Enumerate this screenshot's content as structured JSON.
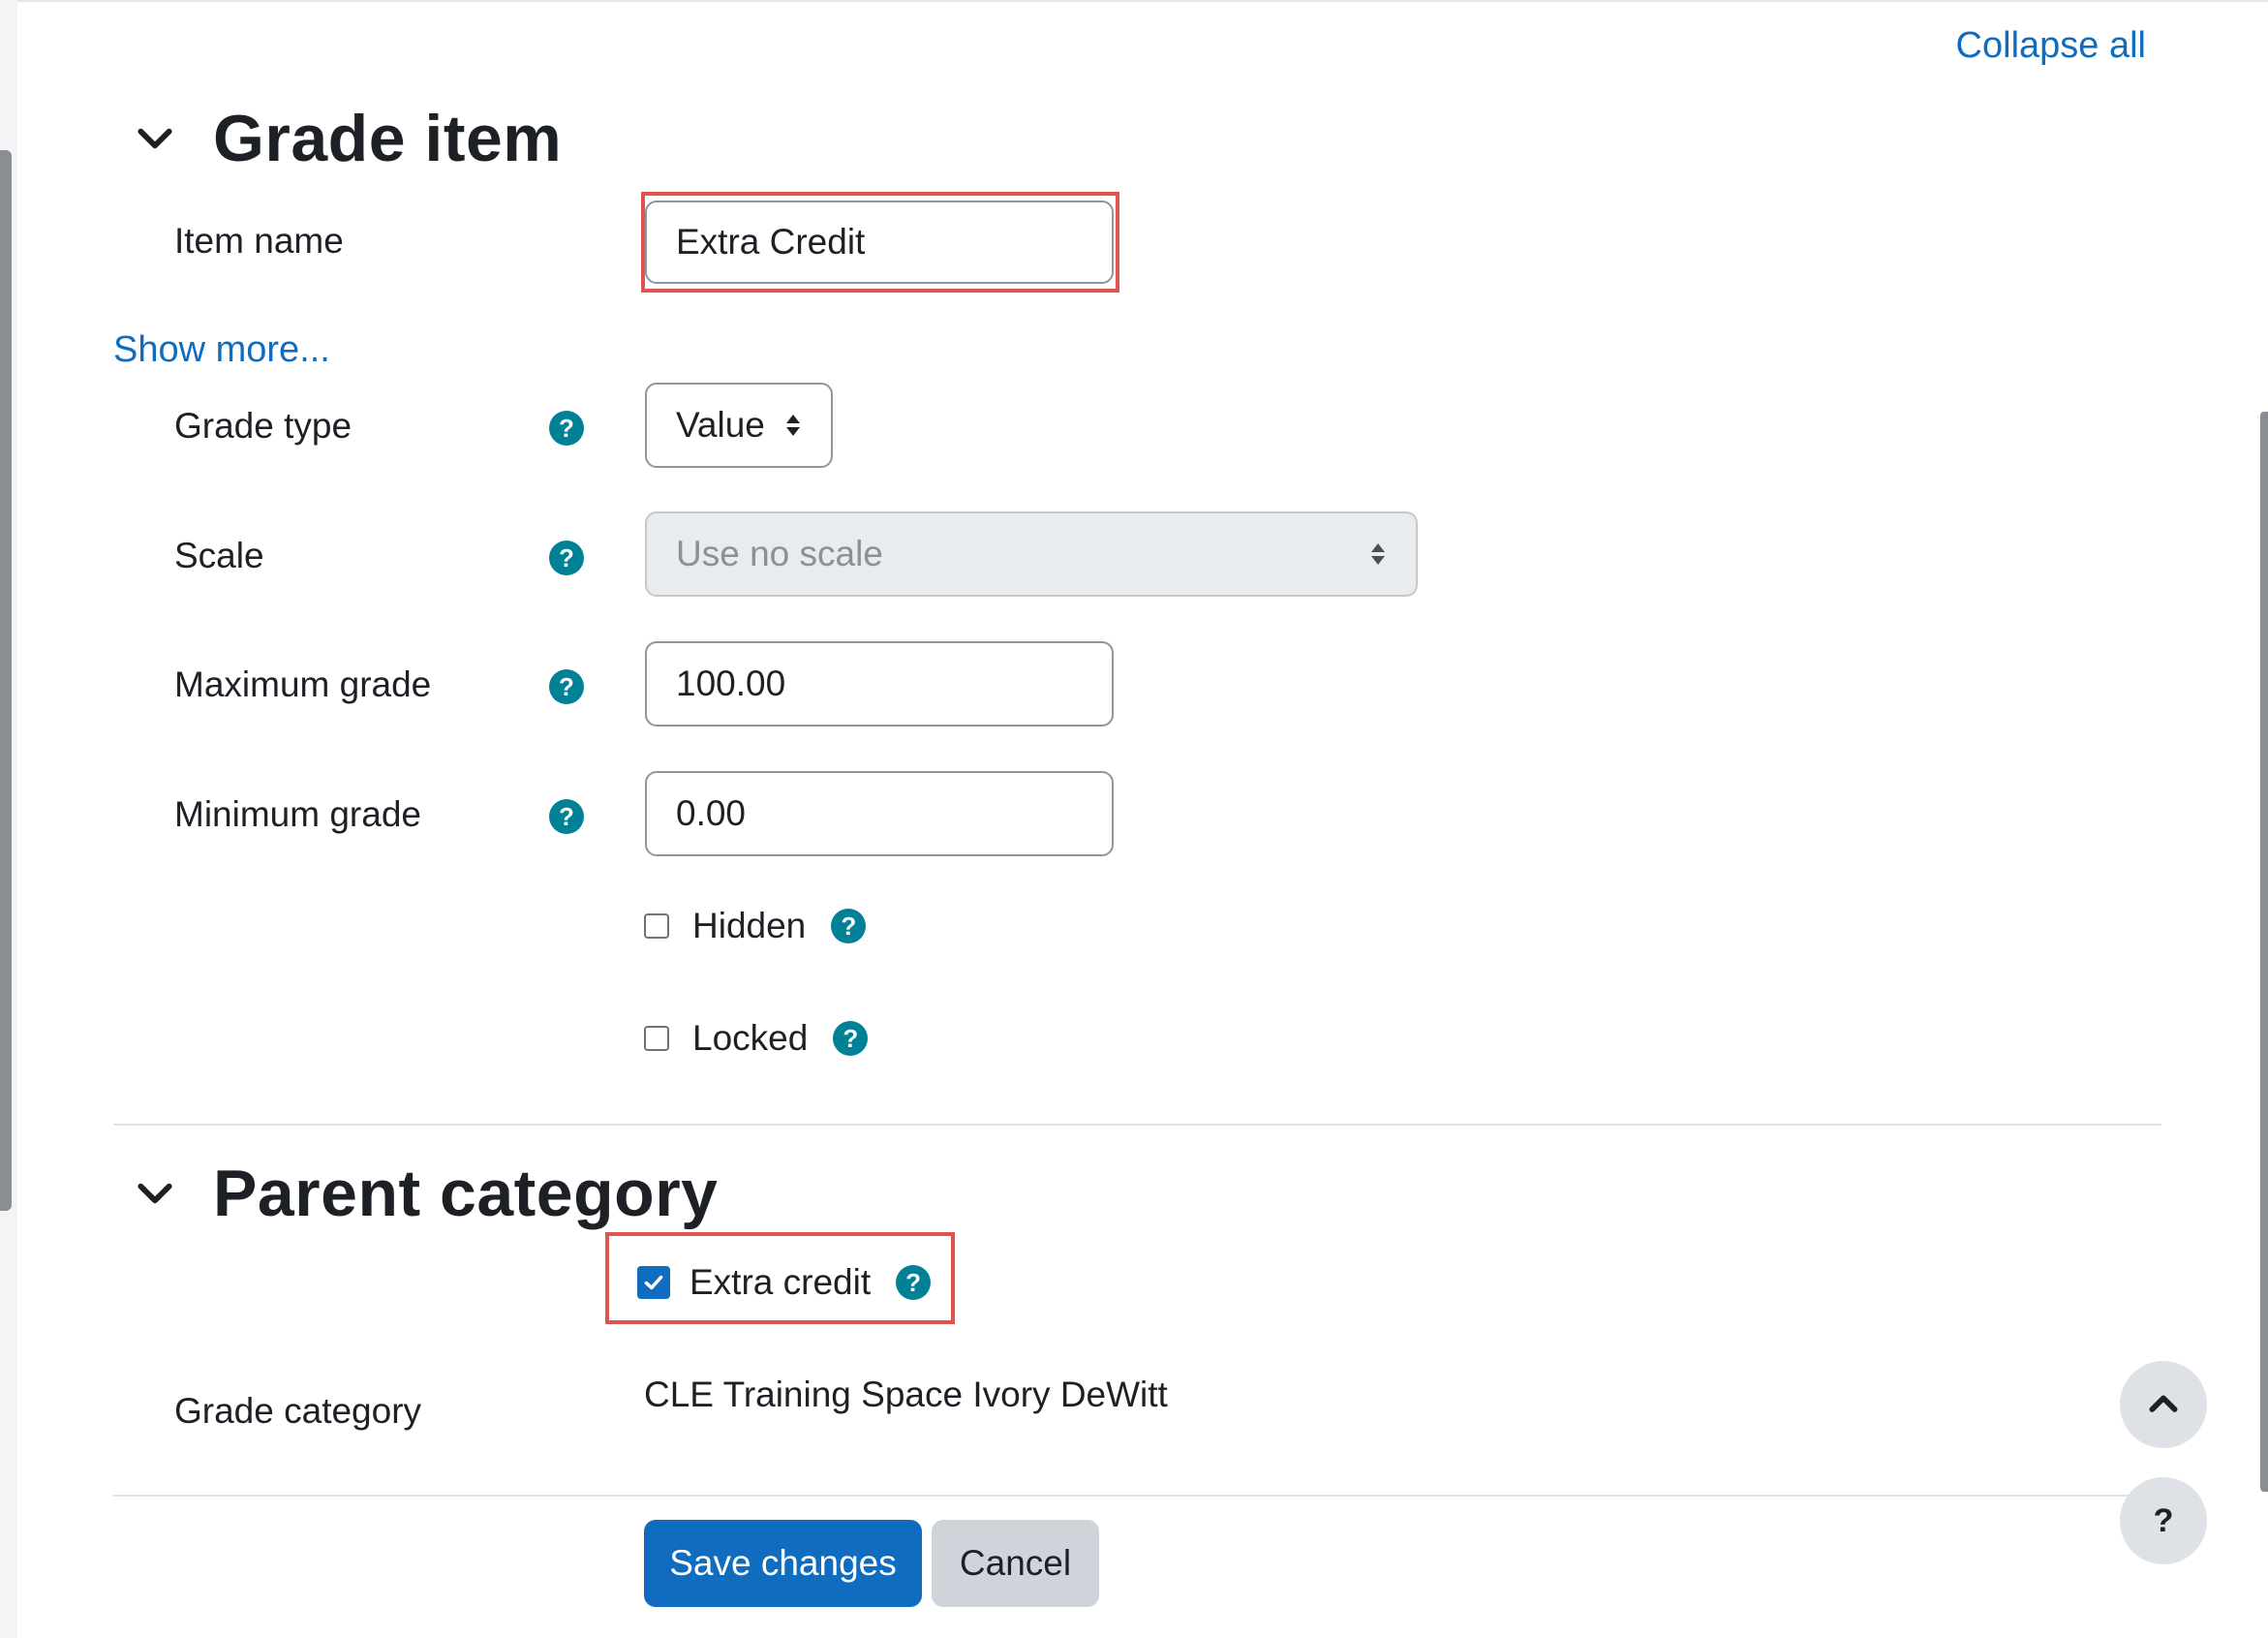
{
  "header": {
    "collapse_all": "Collapse all"
  },
  "grade_item": {
    "title": "Grade item",
    "item_name_label": "Item name",
    "item_name_value": "Extra Credit",
    "show_more": "Show more...",
    "grade_type_label": "Grade type",
    "grade_type_value": "Value",
    "scale_label": "Scale",
    "scale_value": "Use no scale",
    "max_grade_label": "Maximum grade",
    "max_grade_value": "100.00",
    "min_grade_label": "Minimum grade",
    "min_grade_value": "0.00",
    "hidden_label": "Hidden",
    "locked_label": "Locked"
  },
  "parent_category": {
    "title": "Parent category",
    "extra_credit_label": "Extra credit",
    "extra_credit_checked": true,
    "grade_category_label": "Grade category",
    "grade_category_value": "CLE Training Space Ivory DeWitt"
  },
  "actions": {
    "save": "Save changes",
    "cancel": "Cancel"
  },
  "icons": {
    "help": "question-circle-icon",
    "chevron": "chevron-down-icon",
    "back_to_top": "chevron-up-icon",
    "page_help": "question-icon"
  },
  "colors": {
    "accent": "#0f6cbf",
    "help_icon": "#008196",
    "highlight": "#e0534e"
  }
}
